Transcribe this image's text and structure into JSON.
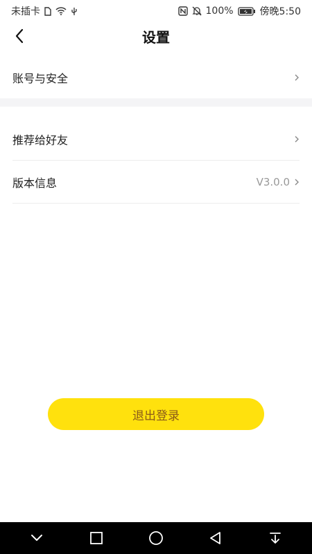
{
  "status_bar": {
    "carrier": "未插卡",
    "battery": "100%",
    "time": "傍晚5:50"
  },
  "header": {
    "title": "设置"
  },
  "settings": {
    "account_security": "账号与安全",
    "recommend": "推荐给好友",
    "version_label": "版本信息",
    "version_value": "V3.0.0"
  },
  "logout": {
    "label": "退出登录"
  },
  "colors": {
    "accent": "#ffe10d",
    "logout_text": "#8a5a1a"
  }
}
